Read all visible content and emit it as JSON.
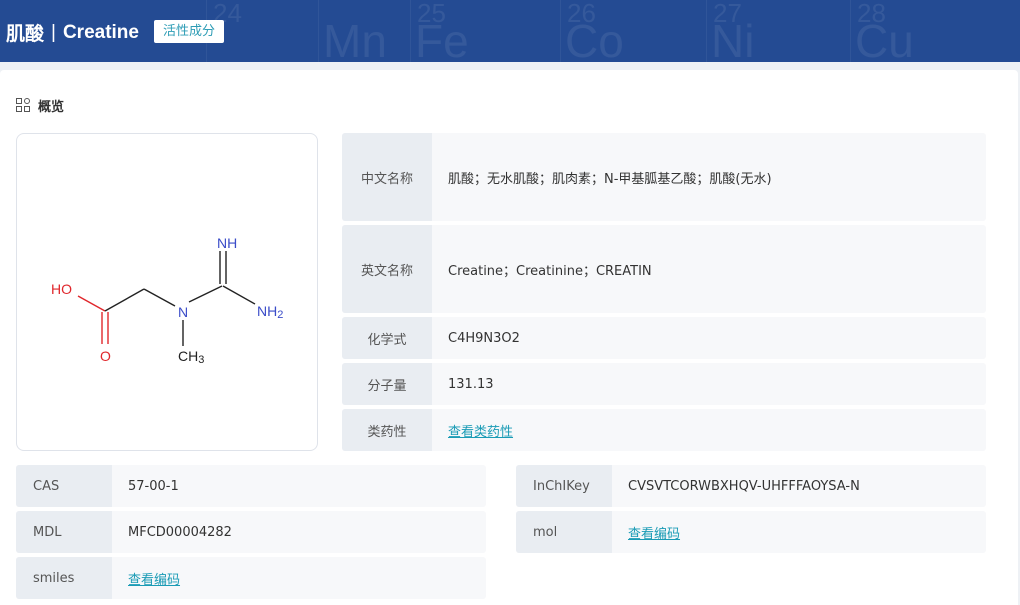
{
  "header": {
    "title_cn": "肌酸",
    "separator": "|",
    "title_en": "Creatine",
    "tag": "活性成分",
    "background_elements": [
      {
        "num": "24",
        "sym": ""
      },
      {
        "num": "24",
        "sym": "Mn"
      },
      {
        "num": "25",
        "sym": "Fe"
      },
      {
        "num": "26",
        "sym": "Co"
      },
      {
        "num": "27",
        "sym": "Ni"
      },
      {
        "num": "28",
        "sym": "Cu"
      }
    ]
  },
  "overview": {
    "title": "概览"
  },
  "structure": {
    "atoms": {
      "nh": "NH",
      "ho": "HO",
      "n": "N",
      "nh2": "NH",
      "nh2_sub": "2",
      "o": "O",
      "ch3": "CH",
      "ch3_sub": "3"
    },
    "colors": {
      "nitrogen": "#3a4cc8",
      "oxygen": "#e0262b",
      "carbon": "#222222"
    }
  },
  "properties": [
    {
      "label": "中文名称",
      "value": "肌酸；无水肌酸；肌肉素；N-甲基胍基乙酸；肌酸(无水)"
    },
    {
      "label": "英文名称",
      "value": "Creatine；Creatinine；CREATIN"
    },
    {
      "label": "化学式",
      "value": "C4H9N3O2"
    },
    {
      "label": "分子量",
      "value": "131.13"
    },
    {
      "label": "类药性",
      "value": "查看类药性"
    }
  ],
  "identifiers_left": [
    {
      "label": "CAS",
      "value": "57-00-1"
    },
    {
      "label": "MDL",
      "value": "MFCD00004282"
    },
    {
      "label": "smiles",
      "value": "查看编码"
    }
  ],
  "identifiers_right": [
    {
      "label": "InChIKey",
      "value": "CVSVTCORWBXHQV-UHFFFAOYSA-N"
    },
    {
      "label": "mol",
      "value": "查看编码"
    }
  ],
  "colors": {
    "header_bg": "#244b93",
    "link": "#1a9bb5",
    "label_bg": "#e9edf2",
    "value_bg": "#f7f8fa"
  }
}
